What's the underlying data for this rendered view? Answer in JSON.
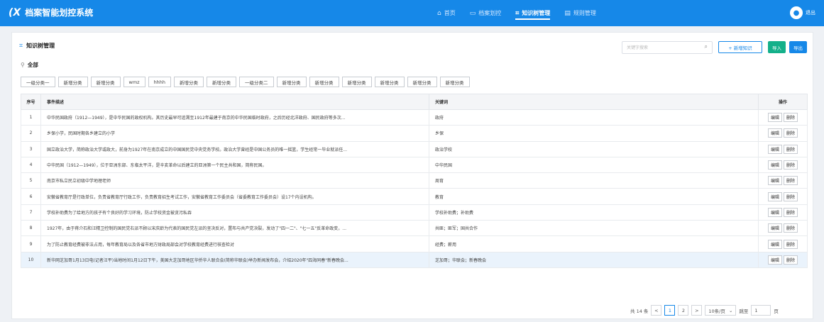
{
  "header": {
    "app_title": "档案智能划控系统",
    "nav": [
      {
        "label": "首页",
        "icon": "home-icon"
      },
      {
        "label": "档案划控",
        "icon": "archive-icon"
      },
      {
        "label": "知识树管理",
        "icon": "tree-icon",
        "active": true
      },
      {
        "label": "规则管理",
        "icon": "rules-icon"
      }
    ],
    "logout_label": "退出"
  },
  "page": {
    "title": "知识树管理",
    "search_placeholder": "关键字搜索",
    "add_label": "+ 新增知识",
    "import_label": "导入",
    "export_label": "导出",
    "all_label": "全部",
    "categories": [
      "一级分类一",
      "新增分类",
      "新增分类",
      "wmz",
      "hhhh",
      "新增分类",
      "新增分类",
      "一级分类二",
      "新增分类",
      "新增分类",
      "新增分类",
      "新增分类",
      "新增分类",
      "新增分类"
    ]
  },
  "table": {
    "headers": {
      "no": "序号",
      "desc": "事件描述",
      "keyword": "关键词",
      "ops": "操作"
    },
    "edit_label": "编辑",
    "delete_label": "删除",
    "rows": [
      {
        "no": "1",
        "desc": "中华民国政府（1912—1949），是中华民国的政权机构。其历史最早可追溯至1912年最建于南京的中华民国临时政府，之后历经北洋政府、国民政府等多次...",
        "keyword": "政府"
      },
      {
        "no": "2",
        "desc": "乡保小学，民国时期各乡建立的小学",
        "keyword": "乡保"
      },
      {
        "no": "3",
        "desc": "国立政治大学，简称政治大学或政大，前身为1927年在南京成立的中国国民党中央党务学校。政治大学曾经是中国公务员的唯一摇篮，学生经常一毕业就派任...",
        "keyword": "政治学校"
      },
      {
        "no": "4",
        "desc": "中华民国（1912—1949），位于亚洲东部、东临太平洋，是辛亥革命以后建立的亚洲第一个民主共和国，简称民国。",
        "keyword": "中华民国"
      },
      {
        "no": "5",
        "desc": "南京市私立民立初级中学地理老师",
        "keyword": "周育"
      },
      {
        "no": "6",
        "desc": "安徽省教育厅是行政单位，负责省教育厅行政工作，负责教育招生考试工作，安徽省教育工作委员会（省委教育工作委员会）设17个内设机构。",
        "keyword": "教育"
      },
      {
        "no": "7",
        "desc": "学校补助费为了给地方的孩子有个良好的学习环境，防止学校资金被贪污私吞",
        "keyword": "学校补助费；补助费"
      },
      {
        "no": "8",
        "desc": "1927年，由于蒋介石和汪精卫控制的国民党右派不顾以宋庆龄为代表的国民党左派的坚决反对，置布与共产党决裂，发动了\"四一二\"、\"七一五\"反革命政变，...",
        "keyword": "共匪；匪军；国共合作"
      },
      {
        "no": "9",
        "desc": "为了防止教育经费被非法占用，每年教育局以及各省市地方财政局部会对学校教育经费进行核查检对",
        "keyword": "经费；薪用"
      },
      {
        "no": "10",
        "desc": "新华网芝加哥1月13日电(记者汪平)当地时间1月12日下午，美国大芝加哥地区华侨华人联合会(简称华联会)举办新闻发布会，介绍2020年\"四海同春\"新春晚会...",
        "keyword": "芝加哥；华联会；新春晚会",
        "highlight": true
      }
    ]
  },
  "pager": {
    "total": "共 14 条",
    "prev": "<",
    "pages": [
      "1",
      "2"
    ],
    "next": ">",
    "page_size": "10条/页",
    "jump_label": "跳至",
    "jump_value": "1",
    "page_suffix": "页"
  }
}
